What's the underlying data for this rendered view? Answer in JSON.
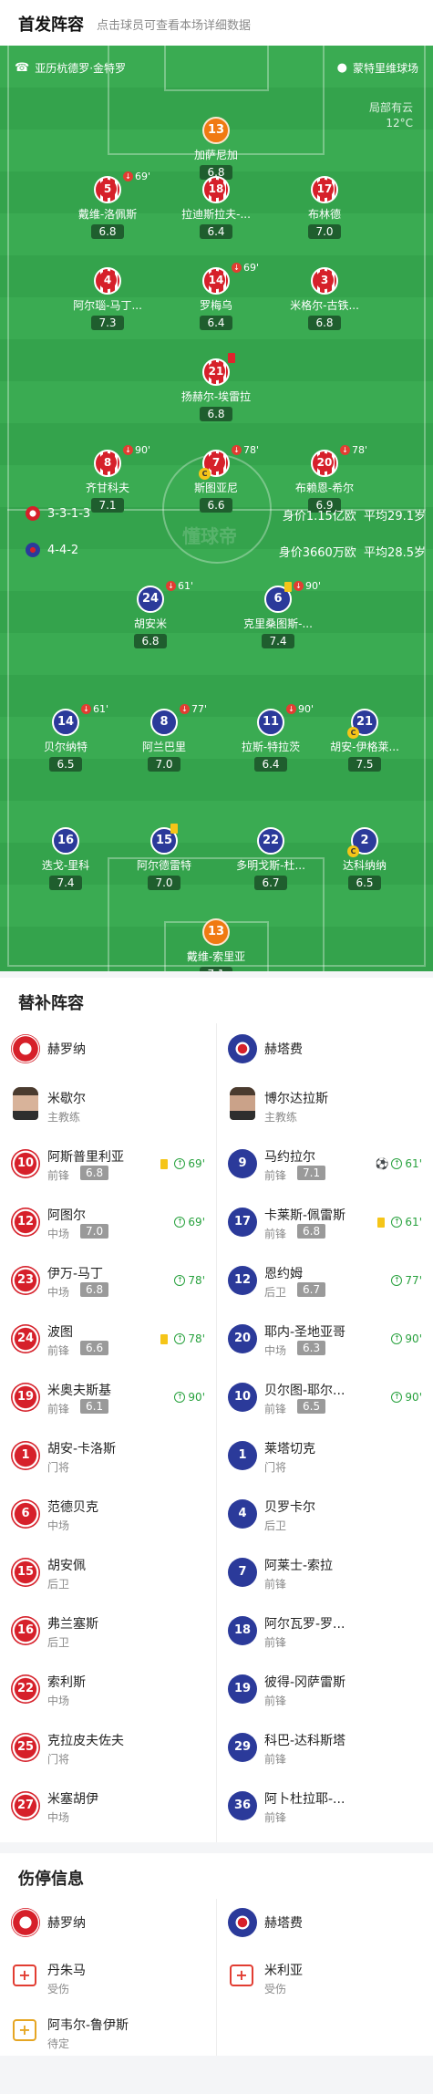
{
  "header": {
    "title": "首发阵容",
    "subtitle": "点击球员可查看本场详细数据"
  },
  "pitch": {
    "venue_left": "亚历杭德罗·金特罗",
    "venue_right": "蒙特里维球场",
    "weather": "局部有云",
    "temperature": "12°C",
    "home_formation": "3-3-1-3",
    "home_value": "身价1.15亿欧",
    "home_age": "平均29.1岁",
    "away_formation": "4-4-2",
    "away_value": "身价3660万欧",
    "away_age": "平均28.5岁",
    "watermark": "懂球帝"
  },
  "home_players": [
    {
      "num": "13",
      "name": "加萨尼加",
      "rating": "6.8"
    },
    {
      "num": "5",
      "name": "戴维-洛佩斯",
      "rating": "6.8",
      "sub": "69'"
    },
    {
      "num": "18",
      "name": "拉迪斯拉夫-...",
      "rating": "6.4"
    },
    {
      "num": "17",
      "name": "布林德",
      "rating": "7.0"
    },
    {
      "num": "4",
      "name": "阿尔瑙-马丁...",
      "rating": "7.3"
    },
    {
      "num": "14",
      "name": "罗梅乌",
      "rating": "6.4",
      "sub": "69'"
    },
    {
      "num": "3",
      "name": "米格尔-古铁...",
      "rating": "6.8"
    },
    {
      "num": "21",
      "name": "扬赫尔-埃雷拉",
      "rating": "6.8"
    },
    {
      "num": "8",
      "name": "齐甘科夫",
      "rating": "7.1",
      "sub": "90'"
    },
    {
      "num": "7",
      "name": "斯图亚尼",
      "rating": "6.6",
      "sub": "78'"
    },
    {
      "num": "20",
      "name": "布赖恩-希尔",
      "rating": "6.9",
      "sub": "78'"
    }
  ],
  "away_players": [
    {
      "num": "24",
      "name": "胡安米",
      "rating": "6.8",
      "sub": "61'"
    },
    {
      "num": "6",
      "name": "克里桑图斯-...",
      "rating": "7.4",
      "sub": "90'"
    },
    {
      "num": "14",
      "name": "贝尔纳特",
      "rating": "6.5",
      "sub": "61'"
    },
    {
      "num": "8",
      "name": "阿兰巴里",
      "rating": "7.0",
      "sub": "77'"
    },
    {
      "num": "11",
      "name": "拉斯-特拉茨",
      "rating": "6.4",
      "sub": "90'"
    },
    {
      "num": "21",
      "name": "胡安-伊格莱...",
      "rating": "7.5"
    },
    {
      "num": "16",
      "name": "迭戈-里科",
      "rating": "7.4"
    },
    {
      "num": "15",
      "name": "阿尔德雷特",
      "rating": "7.0"
    },
    {
      "num": "22",
      "name": "多明戈斯-杜...",
      "rating": "6.7"
    },
    {
      "num": "2",
      "name": "达科纳纳",
      "rating": "6.5"
    },
    {
      "num": "13",
      "name": "戴维-索里亚",
      "rating": "7.1"
    }
  ],
  "subs": {
    "title": "替补阵容",
    "home_team": "赫罗纳",
    "away_team": "赫塔费",
    "home_coach": {
      "name": "米歇尔",
      "role": "主教练"
    },
    "away_coach": {
      "name": "博尔达拉斯",
      "role": "主教练"
    },
    "home": [
      {
        "num": "10",
        "name": "阿斯普里利亚",
        "pos": "前锋",
        "rating": "6.8",
        "time": "69'"
      },
      {
        "num": "12",
        "name": "阿图尔",
        "pos": "中场",
        "rating": "7.0",
        "time": "69'"
      },
      {
        "num": "23",
        "name": "伊万-马丁",
        "pos": "中场",
        "rating": "6.8",
        "time": "78'"
      },
      {
        "num": "24",
        "name": "波图",
        "pos": "前锋",
        "rating": "6.6",
        "time": "78'"
      },
      {
        "num": "19",
        "name": "米奥夫斯基",
        "pos": "前锋",
        "rating": "6.1",
        "time": "90'"
      },
      {
        "num": "1",
        "name": "胡安-卡洛斯",
        "pos": "门将"
      },
      {
        "num": "6",
        "name": "范德贝克",
        "pos": "中场"
      },
      {
        "num": "15",
        "name": "胡安佩",
        "pos": "后卫"
      },
      {
        "num": "16",
        "name": "弗兰塞斯",
        "pos": "后卫"
      },
      {
        "num": "22",
        "name": "索利斯",
        "pos": "中场"
      },
      {
        "num": "25",
        "name": "克拉皮夫佐夫",
        "pos": "门将"
      },
      {
        "num": "27",
        "name": "米塞胡伊",
        "pos": "中场"
      }
    ],
    "away": [
      {
        "num": "9",
        "name": "马约拉尔",
        "pos": "前锋",
        "rating": "7.1",
        "time": "61'"
      },
      {
        "num": "17",
        "name": "卡莱斯-佩雷斯",
        "pos": "前锋",
        "rating": "6.8",
        "time": "61'"
      },
      {
        "num": "12",
        "name": "恩约姆",
        "pos": "后卫",
        "rating": "6.7",
        "time": "77'"
      },
      {
        "num": "20",
        "name": "耶内-圣地亚哥",
        "pos": "中场",
        "rating": "6.3",
        "time": "90'"
      },
      {
        "num": "10",
        "name": "贝尔图-耶尔...",
        "pos": "前锋",
        "rating": "6.5",
        "time": "90'"
      },
      {
        "num": "1",
        "name": "莱塔切克",
        "pos": "门将"
      },
      {
        "num": "4",
        "name": "贝罗卡尔",
        "pos": "后卫"
      },
      {
        "num": "7",
        "name": "阿莱士-索拉",
        "pos": "前锋"
      },
      {
        "num": "18",
        "name": "阿尔瓦罗-罗...",
        "pos": "前锋"
      },
      {
        "num": "19",
        "name": "彼得-冈萨雷斯",
        "pos": "前锋"
      },
      {
        "num": "29",
        "name": "科巴-达科斯塔",
        "pos": "前锋"
      },
      {
        "num": "36",
        "name": "阿卜杜拉耶-...",
        "pos": "前锋"
      }
    ]
  },
  "injuries": {
    "title": "伤停信息",
    "home_team": "赫罗纳",
    "away_team": "赫塔费",
    "home": [
      {
        "name": "丹朱马",
        "status": "受伤"
      },
      {
        "name": "阿韦尔-鲁伊斯",
        "status": "待定"
      }
    ],
    "away": [
      {
        "name": "米利亚",
        "status": "受伤"
      }
    ]
  },
  "colors": {
    "pitch": "#34a34c",
    "home": "#d6202a",
    "away": "#2b3a9a",
    "keeper": "#f07a12"
  }
}
